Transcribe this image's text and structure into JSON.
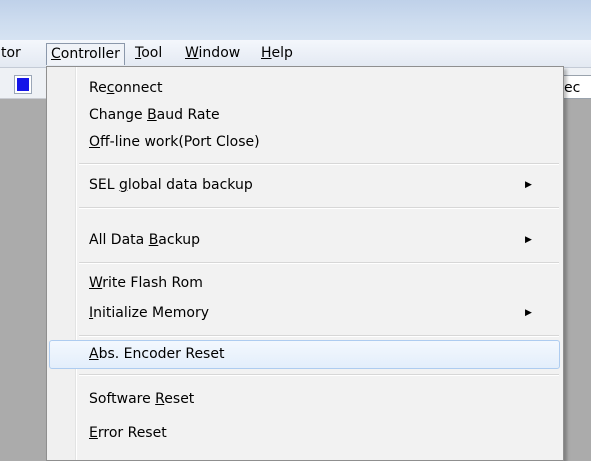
{
  "menubar": {
    "items": [
      {
        "label": "tor",
        "text": "tor"
      },
      {
        "label": "Controller",
        "pre": "",
        "u": "C",
        "post": "ontroller"
      },
      {
        "label": "Tool",
        "pre": "",
        "u": "T",
        "post": "ool"
      },
      {
        "label": "Window",
        "pre": "",
        "u": "W",
        "post": "indow"
      },
      {
        "label": "Help",
        "pre": "",
        "u": "H",
        "post": "elp"
      }
    ]
  },
  "right_field": {
    "text": "ec"
  },
  "colors": {
    "toolbar_button": "#1515e8",
    "highlight_border": "#aeccf0"
  },
  "dropdown": {
    "items": [
      {
        "pre": "Re",
        "u": "c",
        "post": "onnect",
        "submenu": false
      },
      {
        "pre": "Change ",
        "u": "B",
        "post": "aud Rate",
        "submenu": false
      },
      {
        "pre": "",
        "u": "O",
        "post": "ff-line work(Port Close)",
        "submenu": false
      },
      {
        "pre": "SEL ",
        "u": "g",
        "post": "lobal data backup",
        "submenu": true
      },
      {
        "pre": "All Data ",
        "u": "B",
        "post": "ackup",
        "submenu": true
      },
      {
        "pre": "",
        "u": "W",
        "post": "rite Flash Rom",
        "submenu": false
      },
      {
        "pre": "",
        "u": "I",
        "post": "nitialize Memory",
        "submenu": true
      },
      {
        "pre": "",
        "u": "A",
        "post": "bs. Encoder Reset",
        "submenu": false,
        "highlighted": true
      },
      {
        "pre": "Software ",
        "u": "R",
        "post": "eset",
        "submenu": false
      },
      {
        "pre": "",
        "u": "E",
        "post": "rror Reset",
        "submenu": false
      }
    ],
    "submenu_arrow": "▶"
  }
}
